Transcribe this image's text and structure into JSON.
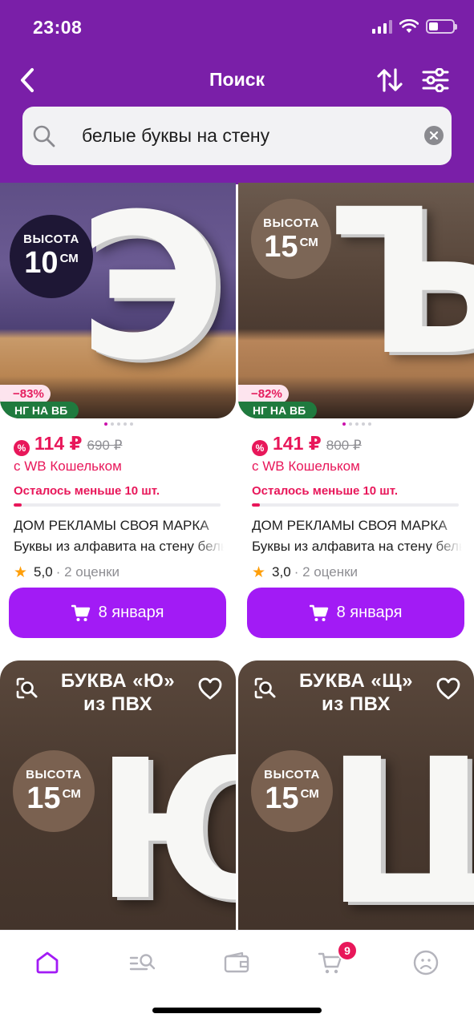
{
  "status_bar": {
    "time": "23:08"
  },
  "nav": {
    "title": "Поиск",
    "back_icon": "chevron-left-icon",
    "sort_icon": "sort-arrows-icon",
    "filter_icon": "sliders-icon"
  },
  "search": {
    "query": "белые буквы на стену"
  },
  "colors": {
    "brand": "#7a1fa8",
    "accent": "#a21bf5",
    "price": "#e8175a",
    "promo_tag": "#1f7a3e",
    "star": "#ff9f0a"
  },
  "products": [
    {
      "letter": "Э",
      "badge_label": "ВЫСОТА",
      "badge_value": "10",
      "badge_unit": "СМ",
      "discount": "−83%",
      "promo": "НГ НА ВБ",
      "price": "114 ₽",
      "old_price": "690 ₽",
      "wallet_text": "с WB Кошельком",
      "stock_text": "Осталось меньше 10 шт.",
      "stock_level": 0.04,
      "brand": "ДОМ РЕКЛАМЫ СВОЯ МАРКА",
      "name": "Буквы из алфавита на стену белые",
      "rating": "5,0",
      "reviews": "· 2 оценки",
      "button": "8 января"
    },
    {
      "letter": "Ъ",
      "badge_label": "ВЫСОТА",
      "badge_value": "15",
      "badge_unit": "СМ",
      "discount": "−82%",
      "promo": "НГ НА ВБ",
      "price": "141 ₽",
      "old_price": "800 ₽",
      "wallet_text": "с WB Кошельком",
      "stock_text": "Осталось меньше 10 шт.",
      "stock_level": 0.04,
      "brand": "ДОМ РЕКЛАМЫ СВОЯ МАРКА",
      "name": "Буквы из алфавита на стену белые",
      "rating": "3,0",
      "reviews": "· 2 оценки",
      "button": "8 января"
    },
    {
      "letter": "Ю",
      "title_line1": "БУКВА «Ю»",
      "title_line2": "из ПВХ",
      "badge_label": "ВЫСОТА",
      "badge_value": "15",
      "badge_unit": "СМ"
    },
    {
      "letter": "Щ",
      "title_line1": "БУКВА «Щ»",
      "title_line2": "из ПВХ",
      "badge_label": "ВЫСОТА",
      "badge_value": "15",
      "badge_unit": "СМ"
    }
  ],
  "tab_bar": {
    "items": [
      {
        "icon": "home-icon",
        "active": true
      },
      {
        "icon": "catalog-search-icon",
        "active": false
      },
      {
        "icon": "wallet-icon",
        "active": false
      },
      {
        "icon": "cart-icon",
        "active": false,
        "badge": "9"
      },
      {
        "icon": "profile-icon",
        "active": false
      }
    ]
  }
}
